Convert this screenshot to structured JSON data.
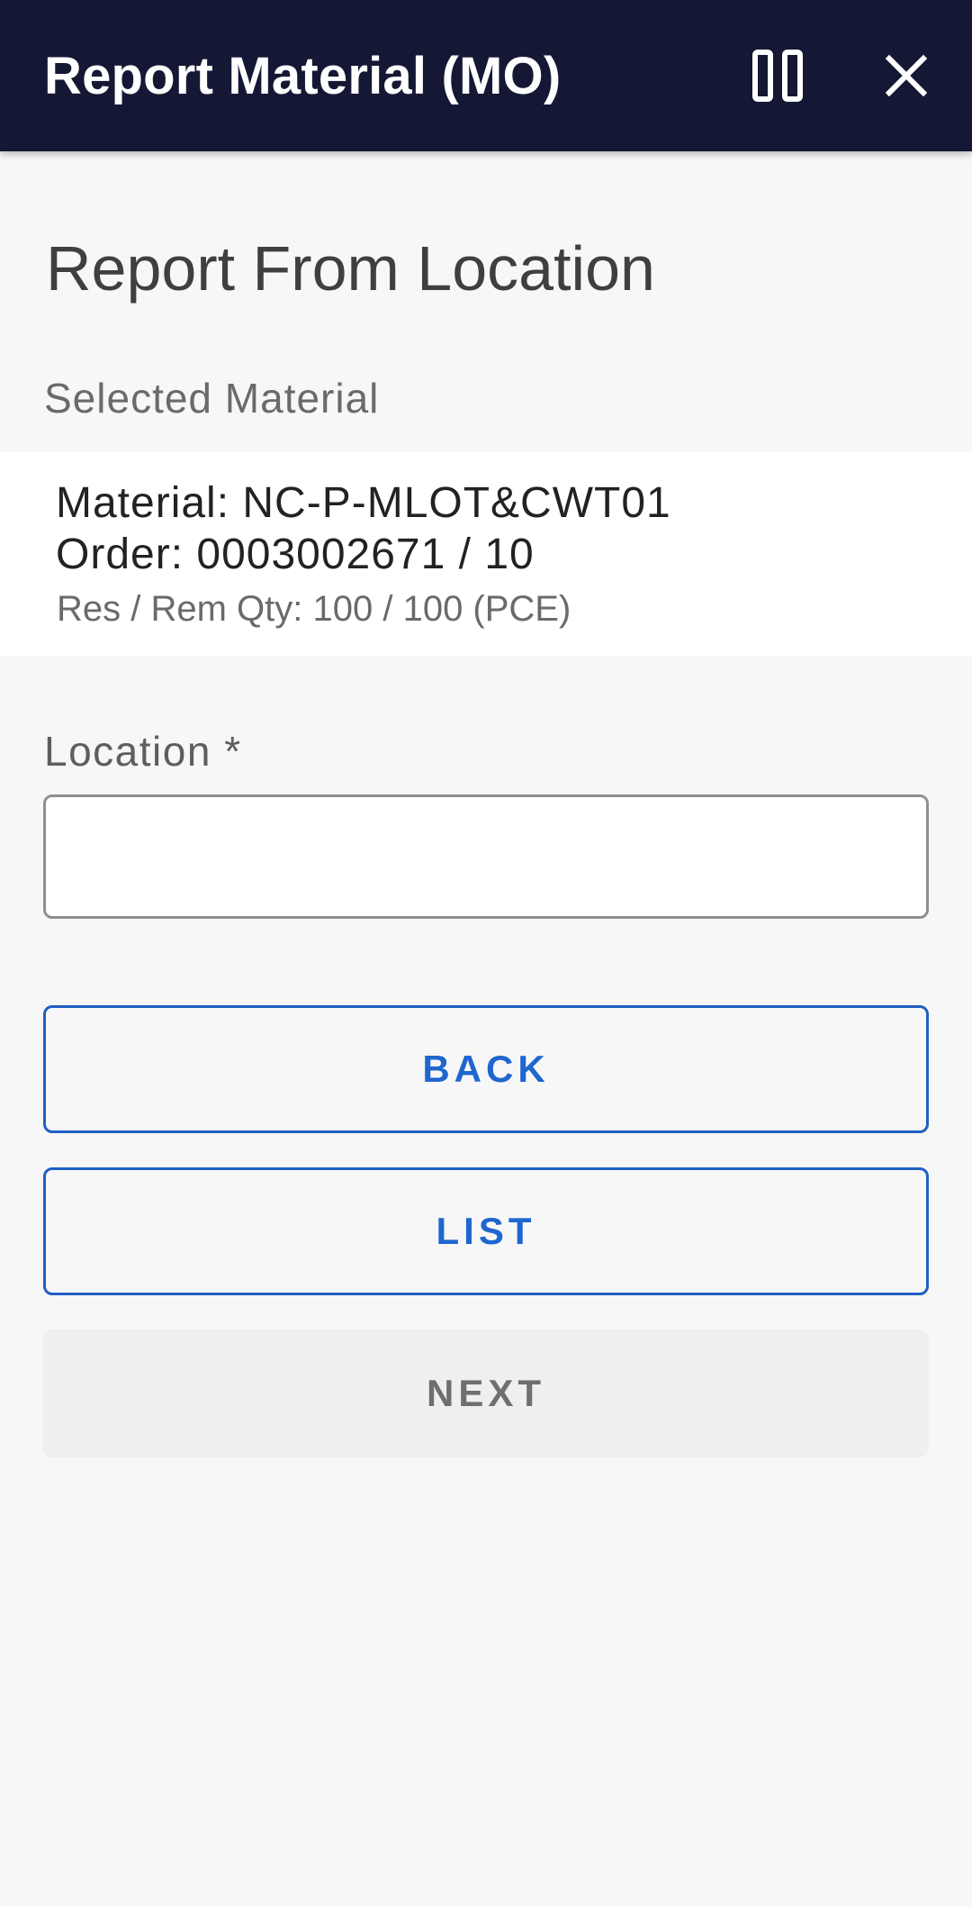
{
  "appbar": {
    "title": "Report Material (MO)",
    "icons": [
      "pause-icon",
      "close-icon"
    ]
  },
  "page": {
    "heading": "Report From Location"
  },
  "selected_material": {
    "label": "Selected Material",
    "material_line": "Material: NC-P-MLOT&CWT01",
    "order_line": "Order: 0003002671 / 10",
    "qty_line": "Res / Rem Qty: 100 / 100 (PCE)"
  },
  "location": {
    "label": "Location *",
    "value": "",
    "placeholder": ""
  },
  "buttons": {
    "back": "BACK",
    "list": "LIST",
    "next": "NEXT"
  },
  "colors": {
    "appbar_bg": "#141834",
    "page_bg": "#f7f7f7",
    "accent": "#1f66cf",
    "disabled_bg": "#efefef",
    "disabled_text": "#6f6f6f"
  }
}
